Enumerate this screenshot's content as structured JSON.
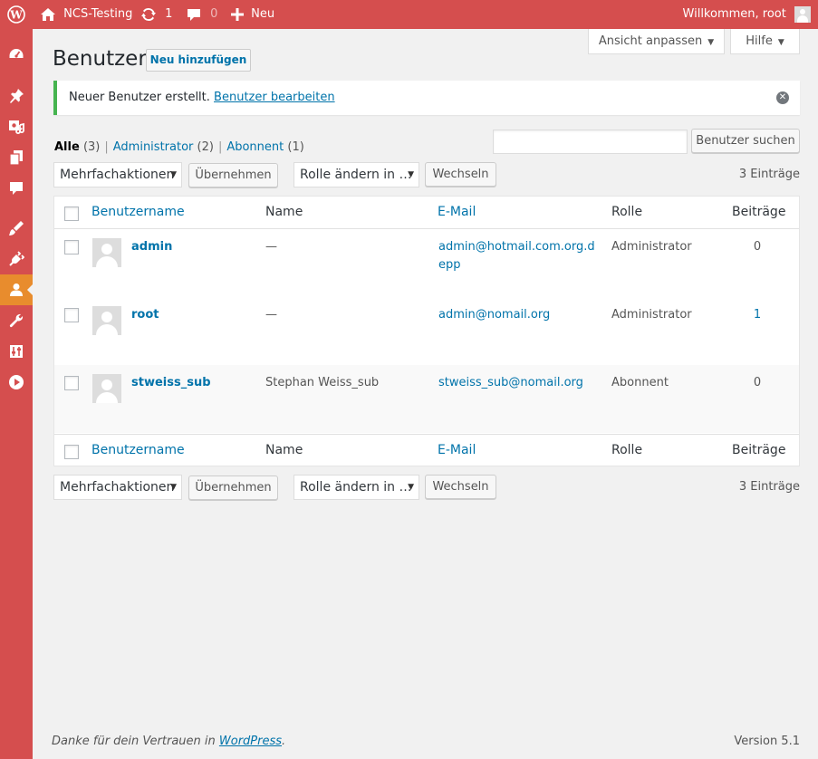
{
  "adminbar": {
    "site_name": "NCS-Testing",
    "updates_count": "1",
    "comments_count": "0",
    "new_label": "Neu",
    "greeting": "Willkommen, root"
  },
  "screen_options": {
    "label": "Ansicht anpassen"
  },
  "help": {
    "label": "Hilfe"
  },
  "page": {
    "title": "Benutzer",
    "add_new_label": "Neu hinzufügen"
  },
  "notice": {
    "text": "Neuer Benutzer erstellt.",
    "link": "Benutzer bearbeiten"
  },
  "views": {
    "all_label": "Alle",
    "all_count": "(3)",
    "admin_label": "Administrator",
    "admin_count": "(2)",
    "subscriber_label": "Abonnent",
    "subscriber_count": "(1)",
    "separator": "|"
  },
  "search": {
    "value": "",
    "button_label": "Benutzer suchen"
  },
  "tablenav": {
    "bulk_actions": "Mehrfachaktionen",
    "apply_label": "Übernehmen",
    "change_role": "Rolle ändern in …",
    "change_label": "Wechseln",
    "items_count": "3 Einträge"
  },
  "columns": {
    "username": "Benutzername",
    "name": "Name",
    "email": "E-Mail",
    "role": "Rolle",
    "posts": "Beiträge"
  },
  "users": [
    {
      "username": "admin",
      "name": "—",
      "email": "admin@hotmail.com.org.depp",
      "role": "Administrator",
      "posts": "0"
    },
    {
      "username": "root",
      "name": "—",
      "email": "admin@nomail.org",
      "role": "Administrator",
      "posts": "1"
    },
    {
      "username": "stweiss_sub",
      "name": "Stephan Weiss_sub",
      "email": "stweiss_sub@nomail.org",
      "role": "Abonnent",
      "posts": "0"
    }
  ],
  "footer": {
    "thanks_prefix": "Danke für dein Vertrauen in",
    "thanks_link": "WordPress",
    "thanks_suffix": ".",
    "version": "Version 5.1"
  },
  "colors": {
    "admin_bar": "#d54e4e",
    "menu_active": "#e88c2d",
    "link": "#0073aa",
    "notice_success": "#46b450"
  },
  "menu_icons": [
    "dashboard-icon",
    "pin-icon",
    "media-icon",
    "pages-icon",
    "comments-icon",
    "appearance-icon",
    "plugins-icon",
    "users-icon",
    "tools-icon",
    "settings-icon",
    "play-icon"
  ]
}
